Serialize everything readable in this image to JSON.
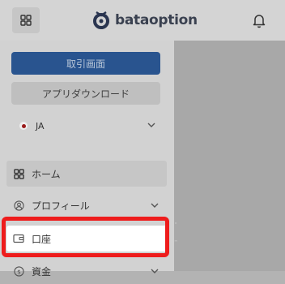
{
  "header": {
    "logo_text": "bataoption",
    "menu_icon": "grid-icon",
    "bell_icon": "bell-icon"
  },
  "sidebar": {
    "primary_button": "取引画面",
    "secondary_button": "アプリダウンロード",
    "language": {
      "label": "JA",
      "flag_icon": "japan-flag-icon"
    },
    "items": [
      {
        "label": "ホーム",
        "icon": "grid-icon",
        "active": true
      },
      {
        "label": "プロフィール",
        "icon": "user-icon",
        "expandable": true
      },
      {
        "label": "口座",
        "icon": "wallet-icon",
        "highlighted": true
      },
      {
        "label": "資金",
        "icon": "coin-icon",
        "expandable": true
      }
    ]
  },
  "colors": {
    "primary": "#29548f",
    "highlight": "#ee1c1c",
    "overlay": "#a8a8a8"
  }
}
